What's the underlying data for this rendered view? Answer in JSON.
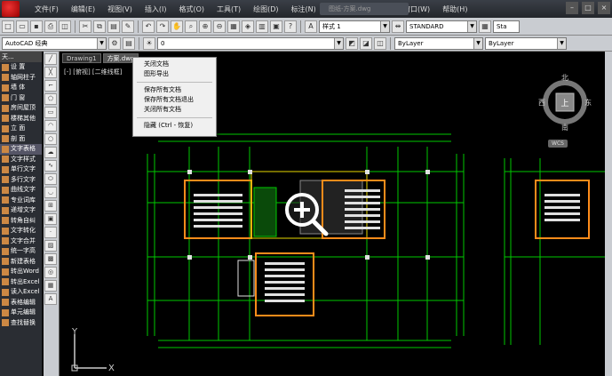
{
  "menubar": {
    "items": [
      "文件(F)",
      "编辑(E)",
      "视图(V)",
      "插入(I)",
      "格式(O)",
      "工具(T)",
      "绘图(D)",
      "标注(N)",
      "修改(M)",
      "参数(P)",
      "窗口(W)",
      "帮助(H)"
    ],
    "title": "图纸-方案.dwg",
    "minimize": "–",
    "maximize": "□",
    "close": "×"
  },
  "toolbar": {
    "textstyle": "样式 1",
    "dimstyle": "STANDARD",
    "workspace": "AutoCAD 经典",
    "layer": "0",
    "color": "ByLayer",
    "linetype": "ByLayer",
    "tablestyle": "Sta"
  },
  "left_panel": {
    "title": "天...",
    "items": [
      "设  置",
      "轴网柱子",
      "墙  体",
      "门  窗",
      "房间屋顶",
      "楼梯其他",
      "立  面",
      "剖  面",
      "文字表格",
      "文字样式",
      "单行文字",
      "多行文字",
      "曲线文字",
      "专业词库",
      "递增文字",
      "转角自纠",
      "文字转化",
      "文字合并",
      "统一字高",
      "新建表格",
      "转出Word",
      "转出Excel",
      "读入Excel",
      "表格编辑",
      "单元编辑",
      "查找替换"
    ]
  },
  "tabs": [
    "Drawing1",
    "方案.dwg"
  ],
  "viewport_label": "[-] [俯视] [二维线框]",
  "context_menu": {
    "items": [
      "关闭文档",
      "图形导出"
    ],
    "items2": [
      "保存所有文档",
      "保存所有文档退出",
      "关闭所有文档"
    ],
    "items3": [
      "隐藏 (Ctrl - 恢复)"
    ]
  },
  "compass": {
    "north": "北",
    "south": "南",
    "east": "东",
    "west": "西",
    "top": "上"
  },
  "wcs": "WCS",
  "ucs": {
    "x": "X",
    "y": "Y"
  },
  "colors": {
    "green": "#00c800",
    "yellow": "#e8d800",
    "orange": "#ff8c1a",
    "white": "#e0e0e0"
  }
}
